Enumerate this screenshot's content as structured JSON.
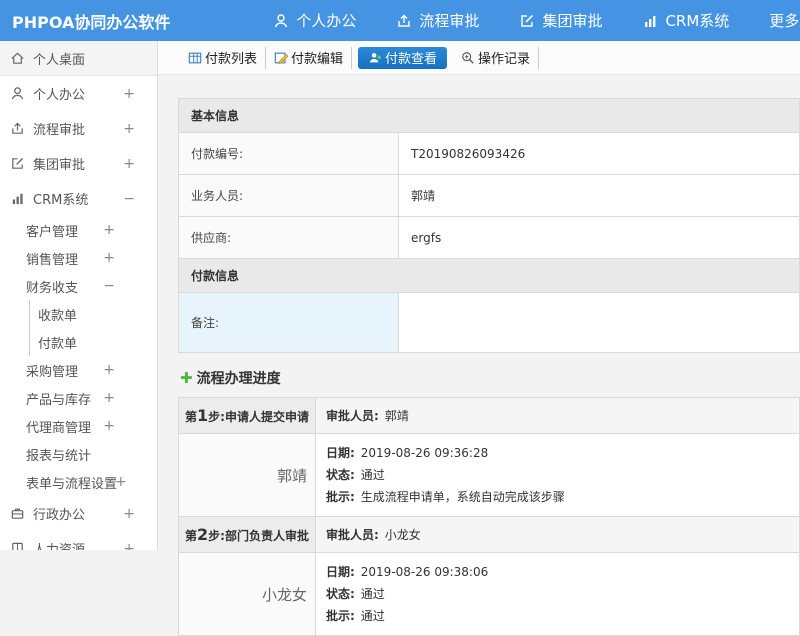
{
  "colors": {
    "topbar-bg": "#4594e4",
    "active-tab": "#1e7fd0",
    "page-bg": "#f3f3f3",
    "section-bg": "#e9e9e9",
    "label-bg": "#fafafa",
    "remark-bg": "#e8f4fc",
    "green": "#52b646"
  },
  "app": {
    "logo": "PHPOA协同办公软件"
  },
  "topnav": {
    "items": [
      {
        "label": "个人办公"
      },
      {
        "label": "流程审批"
      },
      {
        "label": "集团审批"
      },
      {
        "label": "CRM系统"
      },
      {
        "label": "更多应用"
      }
    ]
  },
  "sidebar": {
    "items": [
      {
        "label": "个人桌面",
        "expander": ""
      },
      {
        "label": "个人办公",
        "expander": "+"
      },
      {
        "label": "流程审批",
        "expander": "+"
      },
      {
        "label": "集团审批",
        "expander": "+"
      },
      {
        "label": "CRM系统",
        "expander": "−"
      },
      {
        "label": "客户管理",
        "expander": "+"
      },
      {
        "label": "销售管理",
        "expander": "+"
      },
      {
        "label": "财务收支",
        "expander": "−"
      },
      {
        "label": "收款单",
        "expander": ""
      },
      {
        "label": "付款单",
        "expander": ""
      },
      {
        "label": "采购管理",
        "expander": "+"
      },
      {
        "label": "产品与库存",
        "expander": "+"
      },
      {
        "label": "代理商管理",
        "expander": "+"
      },
      {
        "label": "报表与统计",
        "expander": ""
      },
      {
        "label": "表单与流程设置",
        "expander": "+"
      },
      {
        "label": "行政办公",
        "expander": "+"
      },
      {
        "label": "人力资源",
        "expander": "+"
      }
    ]
  },
  "tabs": [
    {
      "label": "付款列表"
    },
    {
      "label": "付款编辑"
    },
    {
      "label": "付款查看"
    },
    {
      "label": "操作记录"
    }
  ],
  "form": {
    "section1_title": "基本信息",
    "rows": [
      {
        "label": "付款编号:",
        "value": "T20190826093426"
      },
      {
        "label": "业务人员:",
        "value": "郭靖"
      },
      {
        "label": "供应商:",
        "value": "ergfs"
      }
    ],
    "section2_title": "付款信息",
    "remark_label": "备注:",
    "remark_value": ""
  },
  "progress": {
    "title": "流程办理进度",
    "steps": [
      {
        "step_prefix": "第",
        "step_num": "1",
        "step_suffix": "步:申请人提交申请",
        "approver_label": "审批人员:",
        "approver": "郭靖",
        "name": "郭靖",
        "date_label": "日期:",
        "date": "2019-08-26 09:36:28",
        "status_label": "状态:",
        "status": "通过",
        "comment_label": "批示:",
        "comment": "生成流程申请单，系统自动完成该步骤"
      },
      {
        "step_prefix": "第",
        "step_num": "2",
        "step_suffix": "步:部门负责人审批",
        "approver_label": "审批人员:",
        "approver": "小龙女",
        "name": "小龙女",
        "date_label": "日期:",
        "date": "2019-08-26 09:38:06",
        "status_label": "状态:",
        "status": "通过",
        "comment_label": "批示:",
        "comment": "通过"
      }
    ]
  }
}
